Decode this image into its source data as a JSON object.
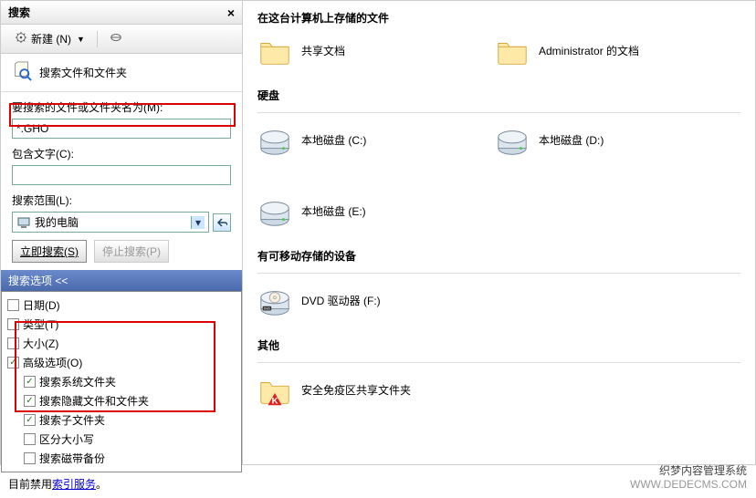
{
  "titlebar": {
    "title": "搜索"
  },
  "toolbar": {
    "new_label": "新建 (N)"
  },
  "search_header": "搜索文件和文件夹",
  "form": {
    "name_label": "要搜索的文件或文件夹名为(M):",
    "name_value": "*.GHO",
    "contains_label": "包含文字(C):",
    "contains_value": "",
    "scope_label": "搜索范围(L):",
    "scope_value": "我的电脑"
  },
  "buttons": {
    "search_now": "立即搜索(S)",
    "stop": "停止搜索(P)"
  },
  "options": {
    "header": "搜索选项 <<",
    "items": [
      {
        "label": "日期(D)",
        "checked": false,
        "indent": false
      },
      {
        "label": "类型(T)",
        "checked": false,
        "indent": false
      },
      {
        "label": "大小(Z)",
        "checked": false,
        "indent": false
      },
      {
        "label": "高级选项(O)",
        "checked": true,
        "indent": false
      },
      {
        "label": "搜索系统文件夹",
        "checked": true,
        "indent": true
      },
      {
        "label": "搜索隐藏文件和文件夹",
        "checked": true,
        "indent": true
      },
      {
        "label": "搜索子文件夹",
        "checked": true,
        "indent": true
      },
      {
        "label": "区分大小写",
        "checked": false,
        "indent": true
      },
      {
        "label": "搜索磁带备份",
        "checked": false,
        "indent": true
      }
    ]
  },
  "index_row": {
    "prefix": "目前禁用",
    "link": "索引服务",
    "suffix": "。"
  },
  "right": {
    "section1_title": "在这台计算机上存储的文件",
    "folders": [
      {
        "label": "共享文档"
      },
      {
        "label": "Administrator 的文档"
      }
    ],
    "section2_title": "硬盘",
    "drives": [
      {
        "label": "本地磁盘 (C:)"
      },
      {
        "label": "本地磁盘 (D:)"
      },
      {
        "label": "本地磁盘 (E:)"
      }
    ],
    "section3_title": "有可移动存储的设备",
    "removable": [
      {
        "label": "DVD 驱动器 (F:)"
      }
    ],
    "section4_title": "其他",
    "other": [
      {
        "label": "安全免疫区共享文件夹"
      }
    ]
  },
  "watermark": {
    "line1": "织梦内容管理系统",
    "line2": "WWW.DEDECMS.COM"
  }
}
